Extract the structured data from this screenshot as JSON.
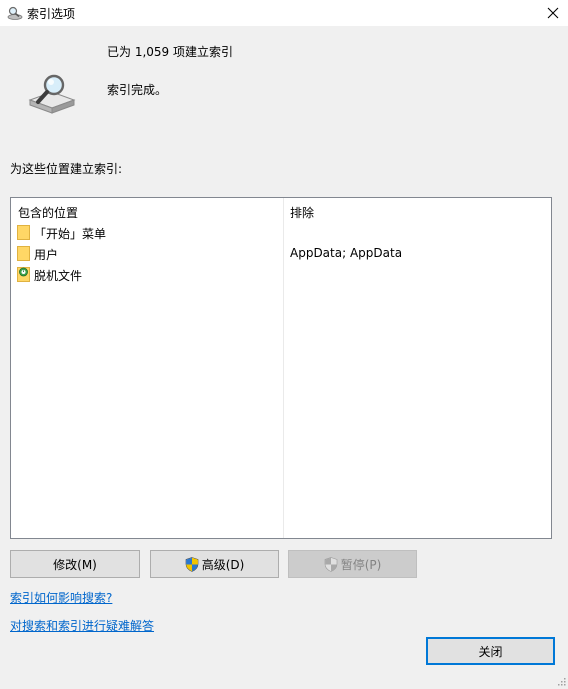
{
  "window": {
    "title": "索引选项"
  },
  "status": {
    "indexed_count": "已为 1,059 项建立索引",
    "message": "索引完成。"
  },
  "locations_label": "为这些位置建立索引:",
  "table": {
    "headers": {
      "included": "包含的位置",
      "excluded": "排除"
    },
    "rows": [
      {
        "name": "「开始」菜单",
        "excluded": "",
        "icon": "folder-icon"
      },
      {
        "name": "用户",
        "excluded": "AppData; AppData",
        "icon": "folder-icon"
      },
      {
        "name": "脱机文件",
        "excluded": "",
        "icon": "offline-files-icon"
      }
    ]
  },
  "buttons": {
    "modify": "修改(M)",
    "advanced": "高级(D)",
    "pause": "暂停(P)",
    "close": "关闭"
  },
  "links": {
    "how_indexing_affects": "索引如何影响搜索?",
    "troubleshoot": "对搜索和索引进行疑难解答"
  },
  "colors": {
    "link": "#0066cc",
    "accent": "#0078d7",
    "folder": "#ffd766"
  }
}
